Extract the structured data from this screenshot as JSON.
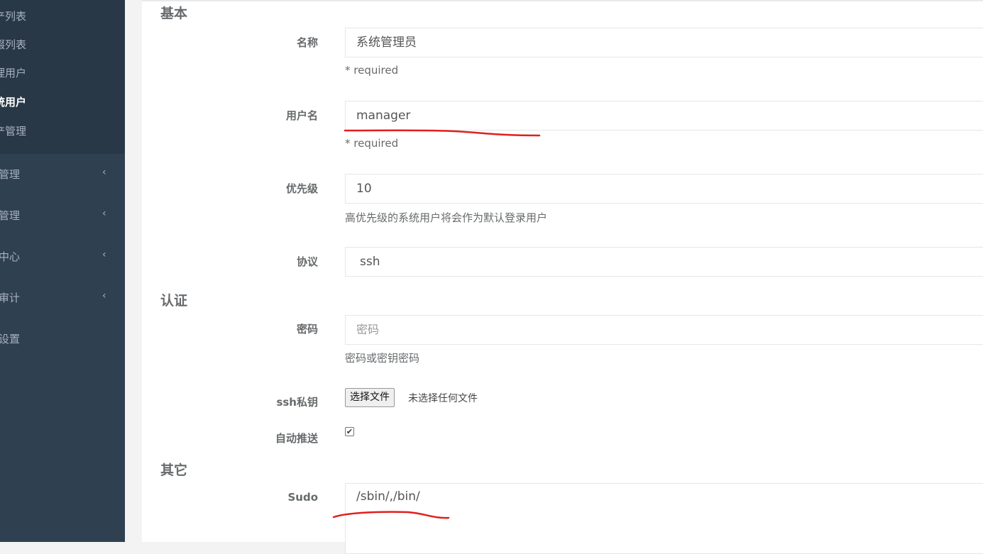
{
  "sidebar": {
    "sub_items": [
      {
        "label": "产列表"
      },
      {
        "label": "缀列表"
      },
      {
        "label": "理用户"
      },
      {
        "label": "统用户",
        "active": true
      },
      {
        "label": "产管理"
      }
    ],
    "menu_items": [
      {
        "label": "管理",
        "icon": "chevron-left-icon"
      },
      {
        "label": "管理",
        "icon": "chevron-left-icon"
      },
      {
        "label": "中心",
        "icon": "chevron-left-icon"
      },
      {
        "label": "审计",
        "icon": "chevron-left-icon"
      },
      {
        "label": "设置"
      }
    ]
  },
  "form": {
    "sections": {
      "basic": "基本",
      "auth": "认证",
      "other": "其它"
    },
    "name": {
      "label": "名称",
      "value": "系统管理员",
      "help": "* required"
    },
    "username": {
      "label": "用户名",
      "value": "manager",
      "help": "* required"
    },
    "priority": {
      "label": "优先级",
      "value": "10",
      "help": "高优先级的系统用户将会作为默认登录用户"
    },
    "protocol": {
      "label": "协议",
      "value": "ssh"
    },
    "password": {
      "label": "密码",
      "placeholder": "密码",
      "help": "密码或密钥密码"
    },
    "ssh_key": {
      "label": "ssh私钥",
      "button": "选择文件",
      "status": "未选择任何文件"
    },
    "auto_push": {
      "label": "自动推送",
      "checked": true,
      "check_glyph": "✔"
    },
    "sudo": {
      "label": "Sudo",
      "value": "/sbin/,/bin/"
    }
  },
  "colors": {
    "sidebar_bg": "#2f4050",
    "sidebar_submenu_bg": "#293846",
    "annotation_ink": "#e0201d"
  }
}
